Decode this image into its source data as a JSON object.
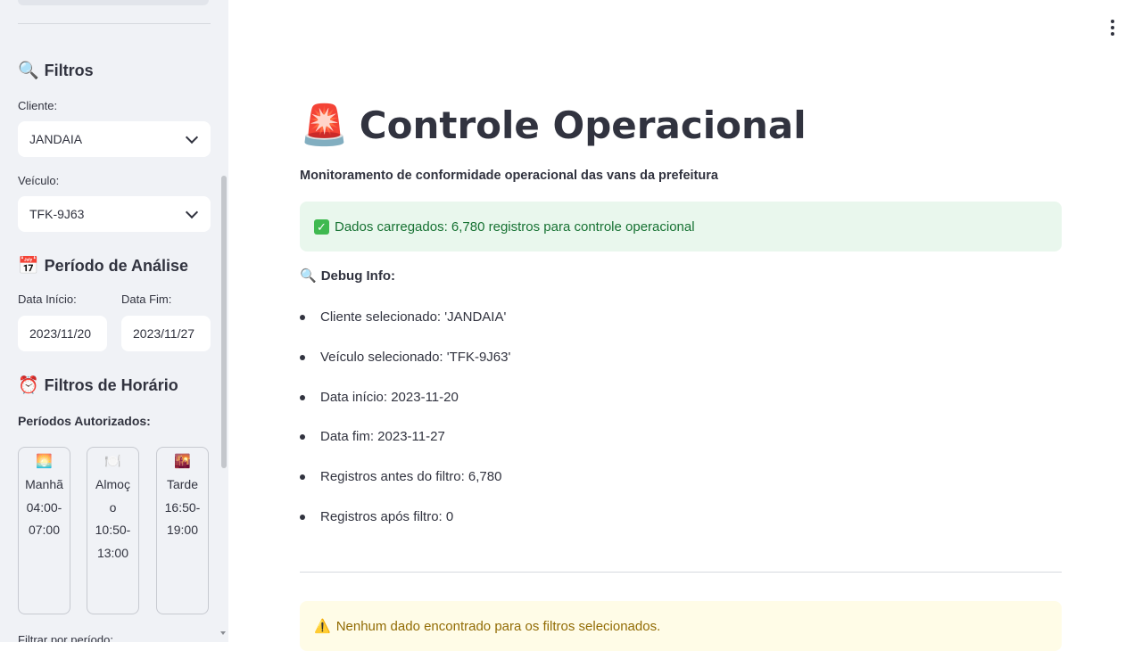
{
  "sidebar": {
    "filters_title": "Filtros",
    "filters_icon": "magnifier-icon",
    "client_label": "Cliente:",
    "client_value": "JANDAIA",
    "vehicle_label": "Veículo:",
    "vehicle_value": "TFK-9J63",
    "period_title": "Período de Análise",
    "period_icon": "calendar-icon",
    "start_label": "Data Início:",
    "start_value": "2023/11/20",
    "end_label": "Data Fim:",
    "end_value": "2023/11/27",
    "time_title": "Filtros de Horário",
    "time_icon": "alarm-clock-icon",
    "authorized_label": "Períodos Autorizados:",
    "periods": [
      {
        "icon": "sunrise-icon",
        "name": "Manhã",
        "range": "04:00-07:00"
      },
      {
        "icon": "plate-cutlery-icon",
        "name": "Almoço",
        "range": "10:50-13:00"
      },
      {
        "icon": "sunset-icon",
        "name": "Tarde",
        "range": "16:50-19:00"
      }
    ],
    "filter_by_period_label": "Filtrar por período:"
  },
  "main": {
    "title": "Controle Operacional",
    "title_icon": "rotating-light-icon",
    "subtitle": "Monitoramento de conformidade operacional das vans da prefeitura",
    "success_message": "Dados carregados: 6,780 registros para controle operacional",
    "success_icon": "check-mark-icon",
    "debug_title": "Debug Info:",
    "debug_items": [
      "Cliente selecionado: 'JANDAIA'",
      "Veículo selecionado: 'TFK-9J63'",
      "Data início: 2023-11-20",
      "Data fim: 2023-11-27",
      "Registros antes do filtro: 6,780",
      "Registros após filtro: 0"
    ],
    "warning_message": "Nenhum dado encontrado para os filtros selecionados.",
    "warning_icon": "warning-icon"
  },
  "colors": {
    "sidebar_bg": "#f0f2f6",
    "success_bg": "#e9f7ed",
    "success_text": "#177233",
    "warning_bg": "#fffce7",
    "warning_text": "#926c05",
    "text": "#31333f"
  }
}
